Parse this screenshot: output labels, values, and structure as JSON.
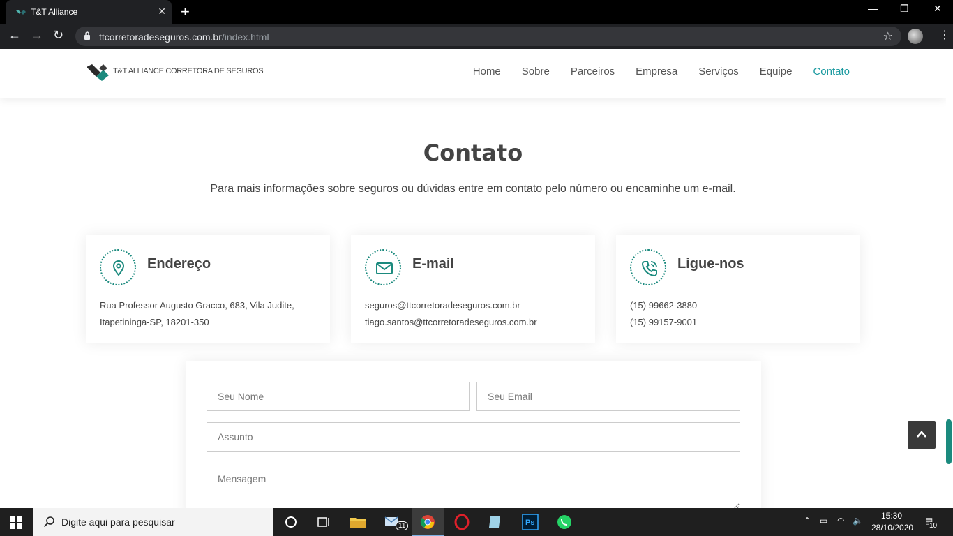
{
  "browser": {
    "tab_title": "T&T Alliance",
    "tab_close": "✕",
    "new_tab": "+",
    "url_domain": "ttcorretoradeseguros.com.br",
    "url_path": "/index.html",
    "window_minimize": "—",
    "window_restore": "❐",
    "window_close": "✕"
  },
  "site": {
    "logo_text": "T&T ALLIANCE CORRETORA DE SEGUROS",
    "nav": [
      "Home",
      "Sobre",
      "Parceiros",
      "Empresa",
      "Serviços",
      "Equipe",
      "Contato"
    ],
    "active_nav": "Contato",
    "contact": {
      "title": "Contato",
      "subtitle": "Para mais informações sobre seguros ou dúvidas entre em contato pelo número ou encaminhe um e-mail.",
      "cards": [
        {
          "title": "Endereço",
          "icon": "map-pin-icon",
          "lines": [
            "Rua Professor Augusto Gracco, 683, Vila Judite,",
            "Itapetininga-SP, 18201-350"
          ]
        },
        {
          "title": "E-mail",
          "icon": "envelope-icon",
          "lines": [
            "seguros@ttcorretoradeseguros.com.br",
            "tiago.santos@ttcorretoradeseguros.com.br"
          ]
        },
        {
          "title": "Ligue-nos",
          "icon": "phone-icon",
          "lines": [
            "(15) 99662-3880",
            "(15) 99157-9001"
          ]
        }
      ],
      "form": {
        "name_placeholder": "Seu Nome",
        "email_placeholder": "Seu Email",
        "subject_placeholder": "Assunto",
        "message_placeholder": "Mensagem"
      }
    },
    "accent_color": "#1b8a7e"
  },
  "taskbar": {
    "search_placeholder": "Digite aqui para pesquisar",
    "mail_badge": "11",
    "time": "15:30",
    "date": "28/10/2020",
    "notifications": "10"
  }
}
